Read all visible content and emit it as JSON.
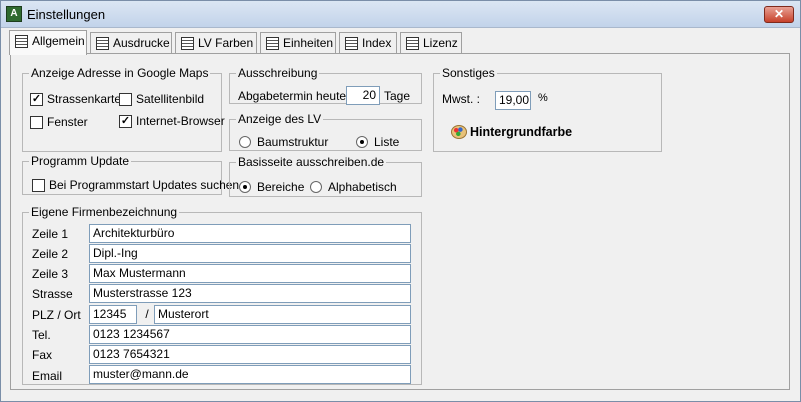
{
  "window": {
    "title": "Einstellungen",
    "close_label": "✕"
  },
  "tabs": [
    {
      "label": "Allgemein"
    },
    {
      "label": "Ausdrucke"
    },
    {
      "label": "LV Farben"
    },
    {
      "label": "Einheiten"
    },
    {
      "label": "Index"
    },
    {
      "label": "Lizenz"
    }
  ],
  "google_maps": {
    "legend": "Anzeige Adresse in Google Maps",
    "strassenkarte": {
      "label": "Strassenkarte",
      "checked": true
    },
    "satellitenbild": {
      "label": "Satellitenbild",
      "checked": false
    },
    "fenster": {
      "label": "Fenster",
      "checked": false
    },
    "internet_browser": {
      "label": "Internet-Browser",
      "checked": true
    }
  },
  "update": {
    "legend": "Programm Update",
    "startup_check": {
      "label": "Bei Programmstart Updates suchen",
      "checked": false
    }
  },
  "ausschreibung": {
    "legend": "Ausschreibung",
    "label_before": "Abgabetermin heute +",
    "days_value": "20",
    "label_after": "Tage"
  },
  "lv_display": {
    "legend": "Anzeige des LV",
    "baumstruktur": {
      "label": "Baumstruktur",
      "selected": false
    },
    "liste": {
      "label": "Liste",
      "selected": true
    }
  },
  "basisseite": {
    "legend": "Basisseite ausschreiben.de",
    "bereiche": {
      "label": "Bereiche",
      "selected": true
    },
    "alphabetisch": {
      "label": "Alphabetisch",
      "selected": false
    }
  },
  "firma": {
    "legend": "Eigene Firmenbezeichnung",
    "fields": [
      {
        "label": "Zeile 1",
        "value": "Architekturbüro"
      },
      {
        "label": "Zeile 2",
        "value": "Dipl.-Ing"
      },
      {
        "label": "Zeile 3",
        "value": "Max Mustermann"
      },
      {
        "label": "Strasse",
        "value": "Musterstrasse 123"
      }
    ],
    "plz_ort": {
      "label": "PLZ / Ort",
      "plz": "12345",
      "separator": "/",
      "ort": "Musterort"
    },
    "tel": {
      "label": "Tel.",
      "value": "0123 1234567"
    },
    "fax": {
      "label": "Fax",
      "value": "0123 7654321"
    },
    "email": {
      "label": "Email",
      "value": "muster@mann.de"
    }
  },
  "sonstiges": {
    "legend": "Sonstiges",
    "mwst_label": "Mwst. :",
    "mwst_value": "19,00",
    "mwst_unit": "%",
    "background_color_label": "Hintergrundfarbe",
    "background_color_icon": "palette-icon"
  }
}
